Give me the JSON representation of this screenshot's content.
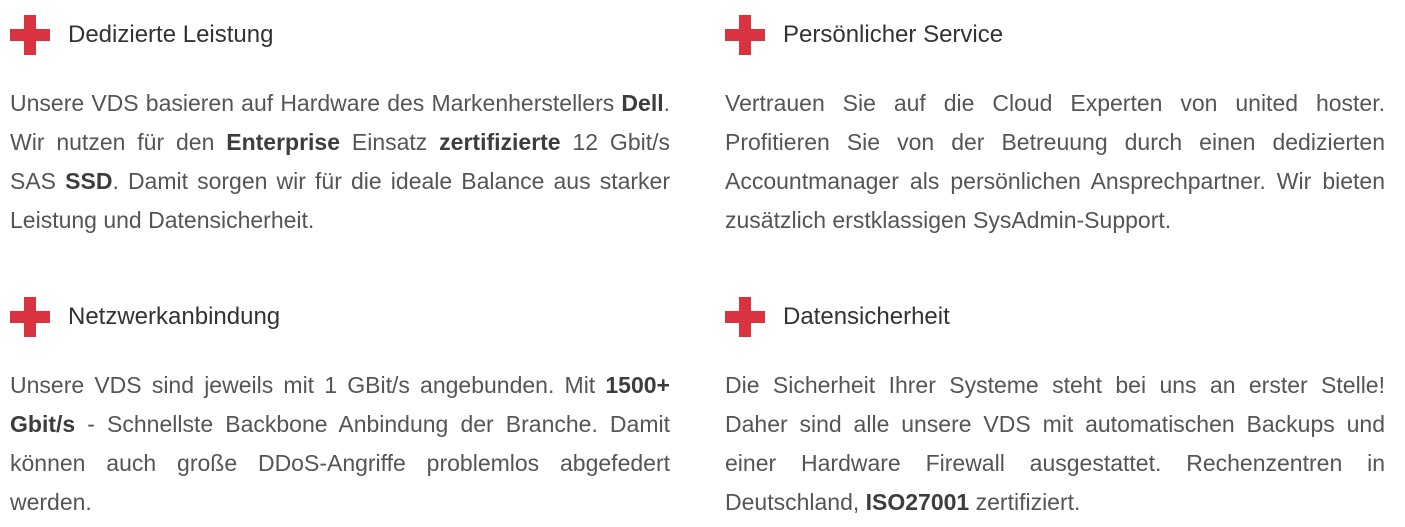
{
  "accent_color": "#d9333f",
  "features": [
    {
      "icon": "plus-icon",
      "title": "Dedizierte Leistung",
      "text": [
        {
          "t": "Unsere VDS basieren auf Hardware des Markenherstellers "
        },
        {
          "t": "Dell",
          "bold": true
        },
        {
          "t": ". Wir nutzen für den "
        },
        {
          "t": "Enterprise",
          "bold": true
        },
        {
          "t": " Einsatz "
        },
        {
          "t": "zertifizierte",
          "bold": true
        },
        {
          "t": " 12 Gbit/s SAS "
        },
        {
          "t": "SSD",
          "bold": true
        },
        {
          "t": ". Damit sorgen wir für die ideale Balance aus starker Leistung und Datensicherheit."
        }
      ]
    },
    {
      "icon": "plus-icon",
      "title": "Persönlicher Service",
      "text": [
        {
          "t": "Vertrauen Sie auf die Cloud Experten von united hoster. Profitieren Sie von der Betreuung durch einen dedizierten Accountmanager als persönlichen Ansprechpartner. Wir bieten zusätzlich erstklassigen SysAdmin-Support."
        }
      ]
    },
    {
      "icon": "plus-icon",
      "title": "Netzwerkanbindung",
      "text": [
        {
          "t": "Unsere VDS sind jeweils mit 1 GBit/s angebunden. Mit "
        },
        {
          "t": "1500+ Gbit/s",
          "bold": true
        },
        {
          "t": " - Schnellste Backbone Anbindung der Branche. Damit können auch große DDoS-Angriffe problemlos abgefedert werden."
        }
      ]
    },
    {
      "icon": "plus-icon",
      "title": "Datensicherheit",
      "text": [
        {
          "t": "Die Sicherheit Ihrer Systeme steht bei uns an erster Stelle! Daher sind alle unsere VDS mit automatischen Backups und einer Hardware Firewall ausgestattet. Rechenzentren in Deutschland, "
        },
        {
          "t": "ISO27001",
          "bold": true
        },
        {
          "t": " zertifiziert."
        }
      ]
    }
  ]
}
